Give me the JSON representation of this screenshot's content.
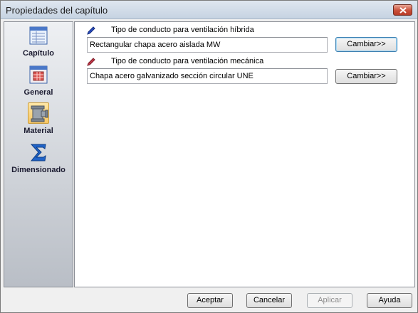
{
  "window": {
    "title": "Propiedades del capítulo"
  },
  "sidebar": {
    "items": [
      {
        "label": "Capítulo",
        "icon": "document-grid-icon",
        "selected": false
      },
      {
        "label": "General",
        "icon": "table-icon",
        "selected": false
      },
      {
        "label": "Material",
        "icon": "pipe-tee-icon",
        "selected": true
      },
      {
        "label": "Dimensionado",
        "icon": "sigma-icon",
        "selected": false
      }
    ]
  },
  "main": {
    "hybrid": {
      "label": "Tipo de conducto para ventilación híbrida",
      "value": "Rectangular chapa acero aislada MW",
      "button": "Cambiar>>"
    },
    "mechanical": {
      "label": "Tipo de conducto para ventilación mecánica",
      "value": "Chapa acero galvanizado sección circular UNE",
      "button": "Cambiar>>"
    }
  },
  "footer": {
    "accept": "Aceptar",
    "cancel": "Cancelar",
    "apply": "Aplicar",
    "help": "Ayuda"
  },
  "colors": {
    "pencil_blue": "#2a4fc4",
    "pencil_red": "#c43a4a",
    "selected_bg": "#f7c765"
  }
}
